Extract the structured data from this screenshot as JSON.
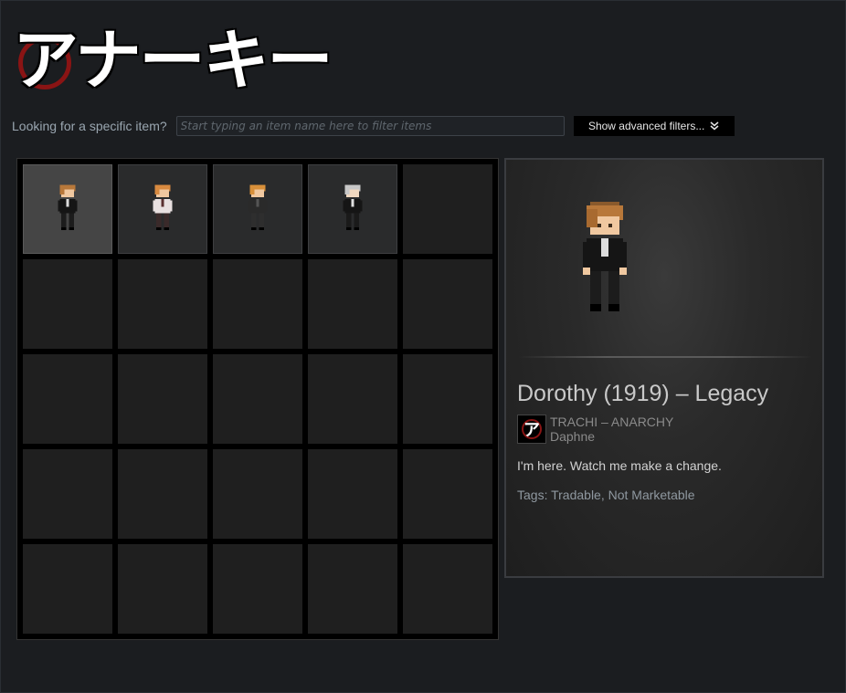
{
  "logo": {
    "text": "アナーキー"
  },
  "filter": {
    "label": "Looking for a specific item?",
    "placeholder": "Start typing an item name here to filter items",
    "advanced_label": "Show advanced filters...",
    "advanced_icon": "double-chevron-down-icon"
  },
  "inventory": {
    "rows": 5,
    "columns": 5,
    "items": [
      {
        "slot": 1,
        "character": "dorothy-black-suit",
        "selected": true
      },
      {
        "slot": 2,
        "character": "girl-striped-shirt",
        "selected": false
      },
      {
        "slot": 3,
        "character": "boy-dark-outfit",
        "selected": false
      },
      {
        "slot": 4,
        "character": "silver-hair-black-suit",
        "selected": false
      }
    ]
  },
  "detail": {
    "name": "Dorothy (1919) – Legacy",
    "game": "TRACHI – ANARCHY",
    "type": "Daphne",
    "description": "I'm here. Watch me make a change.",
    "tags": "Tags: Tradable, Not Marketable"
  },
  "colors": {
    "background": "#1b1d20",
    "accent_red": "#8a1414",
    "button_bg": "#000000"
  }
}
